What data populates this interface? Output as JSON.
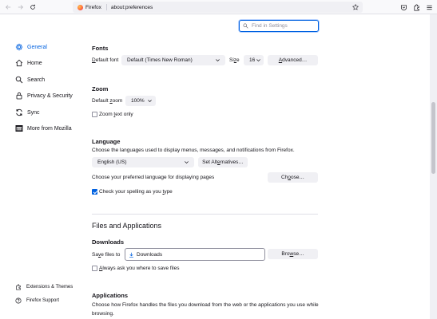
{
  "browser": {
    "identity_label": "Firefox",
    "url": "about:preferences"
  },
  "search": {
    "placeholder": "Find in Settings"
  },
  "sidebar": {
    "items": [
      {
        "label": "General",
        "icon": "gear-icon"
      },
      {
        "label": "Home",
        "icon": "home-icon"
      },
      {
        "label": "Search",
        "icon": "search-icon"
      },
      {
        "label": "Privacy & Security",
        "icon": "lock-icon"
      },
      {
        "label": "Sync",
        "icon": "sync-icon"
      },
      {
        "label": "More from Mozilla",
        "icon": "mozilla-icon"
      }
    ],
    "bottom": [
      {
        "label": "Extensions & Themes",
        "icon": "puzzle-icon"
      },
      {
        "label": "Firefox Support",
        "icon": "help-icon"
      }
    ]
  },
  "fonts": {
    "heading": "Fonts",
    "default_font_label_pre": "D",
    "default_font_label_rest": "efault font",
    "default_font_value": "Default (Times New Roman)",
    "size_label_pre": "Si",
    "size_label_u": "z",
    "size_label_post": "e",
    "size_value": "16",
    "advanced_pre": "",
    "advanced_u": "A",
    "advanced_post": "dvanced…"
  },
  "zoom": {
    "heading": "Zoom",
    "default_zoom_pre": "Default ",
    "default_zoom_u": "z",
    "default_zoom_post": "oom",
    "zoom_value": "100%",
    "text_only_pre": "Zoom ",
    "text_only_u": "t",
    "text_only_post": "ext only"
  },
  "language": {
    "heading": "Language",
    "description": "Choose the languages used to display menus, messages, and notifications from Firefox.",
    "language_value": "English (US)",
    "set_alternatives_pre": "Set Alt",
    "set_alternatives_u": "e",
    "set_alternatives_post": "rnatives…",
    "pages_label": "Choose your preferred language for displaying pages",
    "choose_pre": "Ch",
    "choose_u": "o",
    "choose_post": "ose…",
    "spelling_pre": "Check your spelling as you ",
    "spelling_u": "t",
    "spelling_post": "ype"
  },
  "files": {
    "section_heading": "Files and Applications",
    "downloads_heading": "Downloads",
    "save_files_pre": "Sa",
    "save_files_u": "v",
    "save_files_post": "e files to",
    "save_folder": "Downloads",
    "browse_pre": "Bro",
    "browse_u": "w",
    "browse_post": "se…",
    "always_ask_pre": "",
    "always_ask_u": "A",
    "always_ask_post": "lways ask you where to save files"
  },
  "applications": {
    "heading": "Applications",
    "description": "Choose how Firefox handles the files you download from the web or the applications you use while browsing."
  },
  "colors": {
    "accent": "#0061e0",
    "checkbox_checked": "#0061e0"
  }
}
